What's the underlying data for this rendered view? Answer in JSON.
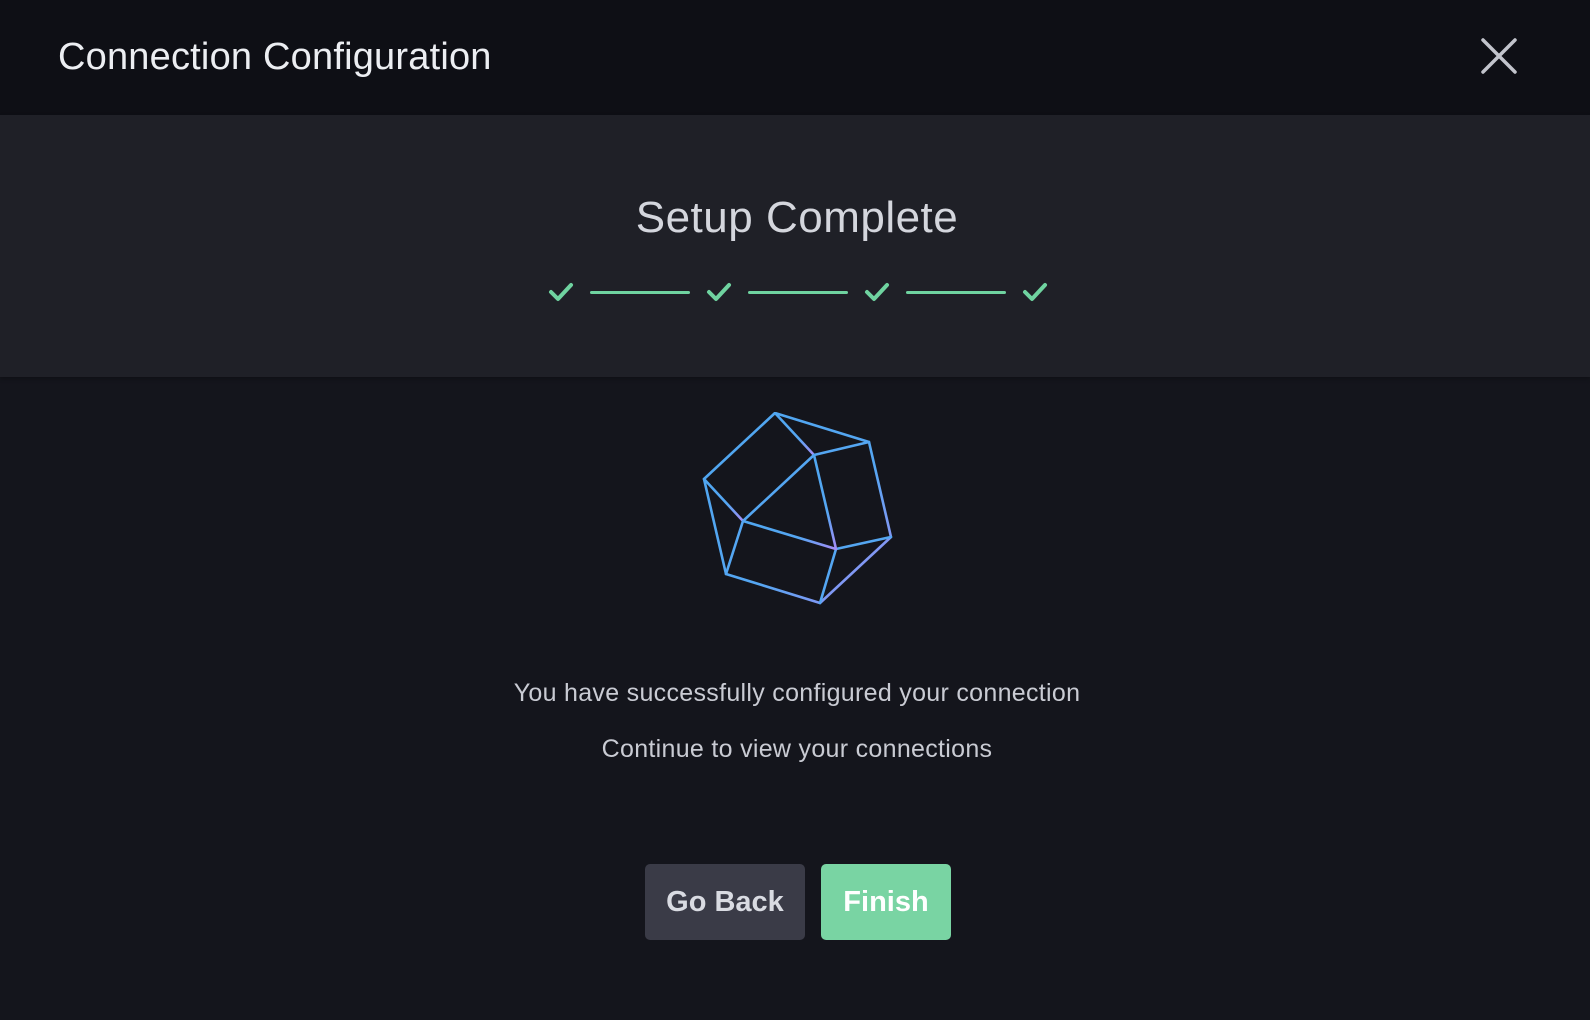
{
  "header": {
    "title": "Connection Configuration",
    "close_icon": "close-icon"
  },
  "stepper": {
    "title": "Setup Complete",
    "steps": [
      {
        "status": "complete"
      },
      {
        "status": "complete"
      },
      {
        "status": "complete"
      },
      {
        "status": "complete"
      }
    ],
    "color": "#6fd3a0"
  },
  "main": {
    "illustration_icon": "polyhedron-icon",
    "message": "You have successfully configured your connection",
    "submessage": "Continue to view your connections"
  },
  "actions": {
    "back_label": "Go Back",
    "finish_label": "Finish"
  },
  "colors": {
    "accent": "#79d4a3",
    "secondary_button": "#3a3b47",
    "illustration_start": "#4fa6f0",
    "illustration_end": "#9b8cf5"
  }
}
